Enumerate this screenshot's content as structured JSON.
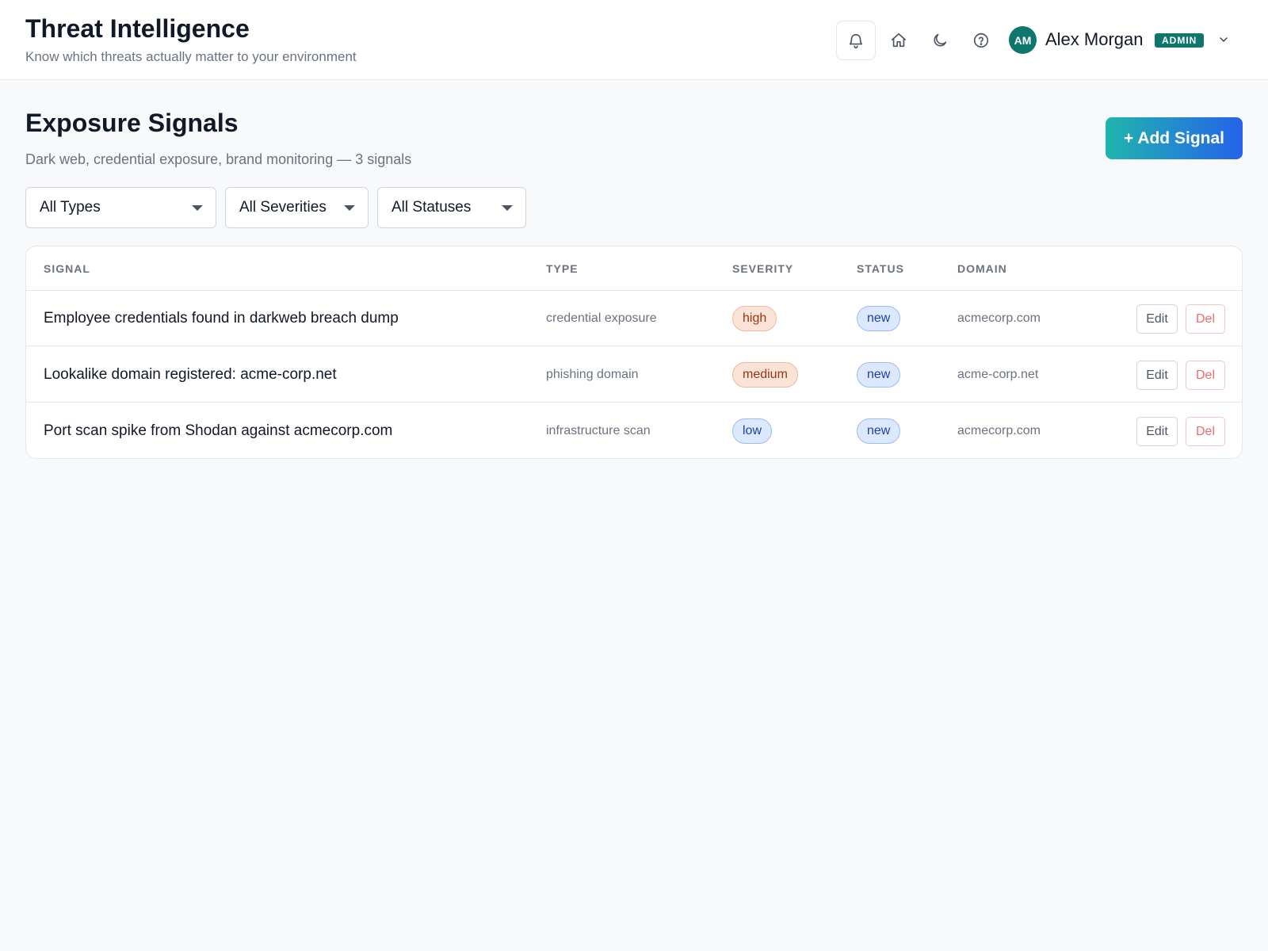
{
  "header": {
    "title": "Threat Intelligence",
    "subtitle": "Know which threats actually matter to your environment",
    "icons": [
      "bell-icon",
      "home-icon",
      "moon-icon",
      "help-icon"
    ],
    "user": {
      "initials": "AM",
      "name": "Alex Morgan",
      "role": "ADMIN"
    }
  },
  "page": {
    "title": "Exposure Signals",
    "description": "Dark web, credential exposure, brand monitoring — 3 signals",
    "add_button": "+ Add Signal"
  },
  "filters": {
    "type": "All Types",
    "severity": "All Severities",
    "status": "All Statuses"
  },
  "table": {
    "columns": [
      "SIGNAL",
      "TYPE",
      "SEVERITY",
      "STATUS",
      "DOMAIN"
    ],
    "rows": [
      {
        "signal": "Employee credentials found in darkweb breach dump",
        "type": "credential exposure",
        "severity": "high",
        "status": "new",
        "domain": "acmecorp.com",
        "edit": "Edit",
        "del": "Del"
      },
      {
        "signal": "Lookalike domain registered: acme-corp.net",
        "type": "phishing domain",
        "severity": "medium",
        "status": "new",
        "domain": "acme-corp.net",
        "edit": "Edit",
        "del": "Del"
      },
      {
        "signal": "Port scan spike from Shodan against acmecorp.com",
        "type": "infrastructure scan",
        "severity": "low",
        "status": "new",
        "domain": "acmecorp.com",
        "edit": "Edit",
        "del": "Del"
      }
    ]
  },
  "colors": {
    "accent_start": "#1fb5ad",
    "accent_end": "#2563eb",
    "brand": "#0f766e",
    "severity_high": "#9a3412",
    "severity_low": "#1e40af",
    "danger": "#ef6b6b"
  }
}
